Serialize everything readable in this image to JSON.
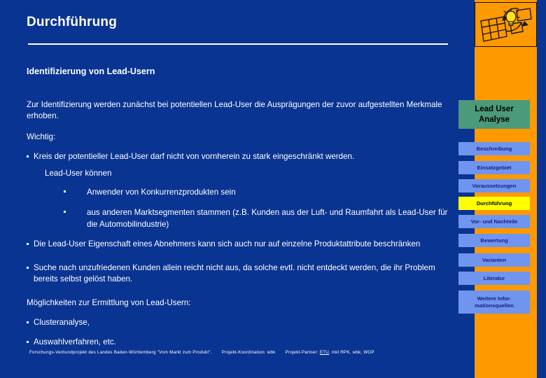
{
  "slide": {
    "title": "Durchführung",
    "section_title": "Identifizierung von Lead-Usern",
    "intro": "Zur Identifizierung werden zunächst bei potentiellen Lead-User die Ausprägungen der zuvor aufgestellten Merkmale erhoben.",
    "note_label": "Wichtig:",
    "bullets": {
      "b1": "Kreis der potentieller Lead-User darf nicht von vornherein zu stark eingeschränkt werden.",
      "b1_sub": "Lead-User können",
      "b1_sub_items": [
        "Anwender von Konkurrenzprodukten sein",
        "aus anderen Marktsegmenten stammen (z.B. Kunden aus der Luft- und Raumfahrt als Lead-User für die Automobilindustrie)"
      ],
      "b2": "Die Lead-User Eigenschaft eines Abnehmers kann sich auch nur auf einzelne Produktattribute beschränken",
      "b3": "Suche nach unzufriedenen Kunden allein reicht nicht aus, da solche evtl. nicht entdeckt werden, die ihr Problem bereits selbst gelöst haben."
    },
    "methods_label": "Möglichkeiten zur Ermittlung von Lead-Usern:",
    "methods": [
      "Clusteranalyse,",
      "Auswahlverfahren, etc."
    ]
  },
  "footer": {
    "project": "Forschungs-Verbundprojekt des Landes Baden-Württemberg \"Vom Markt zum Produkt\".",
    "coordination": "Projekt-Koordination: wbk",
    "partners_prefix": "Projekt-Partner:",
    "partners_link": "ETU",
    "partners_rest": ", mkl RPK, wbk, WOP"
  },
  "sidebar": {
    "header_line1": "Lead User",
    "header_line2": "Analyse",
    "logo_name": "lightbulb-grid-logo",
    "items": [
      {
        "label": "Beschreibung",
        "active": false
      },
      {
        "label": "Einsatzgebiet",
        "active": false
      },
      {
        "label": "Voraussetzungen",
        "active": false
      },
      {
        "label": "Durchführung",
        "active": true
      },
      {
        "label": "Vor- und Nachteile",
        "active": false
      },
      {
        "label": "Bewertung",
        "active": false
      },
      {
        "label": "Varianten",
        "active": false
      },
      {
        "label": "Literatur",
        "active": false
      },
      {
        "label": "Weitere Infor-\nmationsquellen",
        "active": false
      }
    ]
  },
  "colors": {
    "background_blue": "#0a3491",
    "panel_orange": "#ff9900",
    "header_green": "#4b9a79",
    "button_blue": "#6f95ef",
    "button_active_yellow": "#ffff00",
    "text_white": "#ffffff"
  }
}
